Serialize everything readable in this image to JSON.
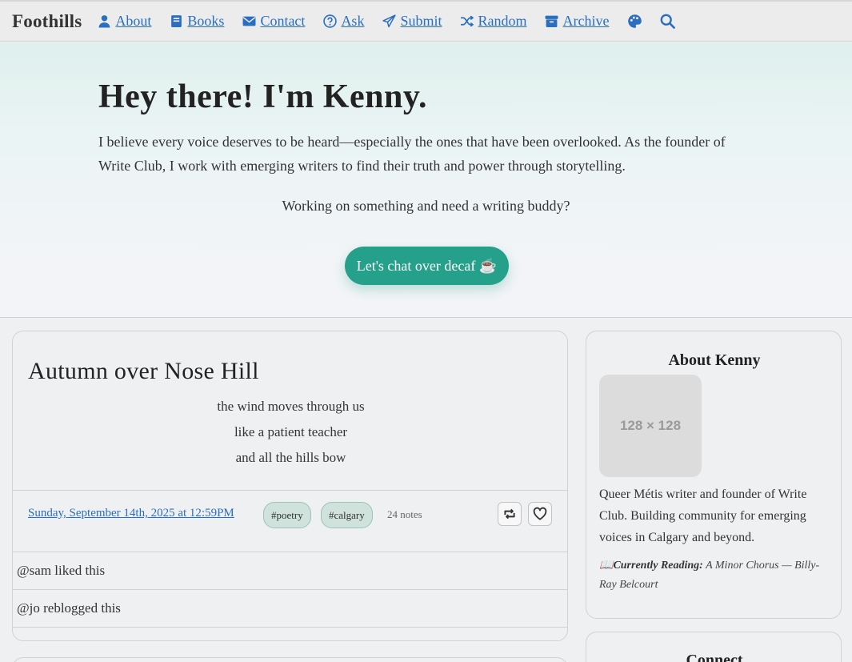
{
  "nav": {
    "brand": "Foothills",
    "links": [
      {
        "label": "About",
        "icon": "user-icon"
      },
      {
        "label": "Books",
        "icon": "book-icon"
      },
      {
        "label": "Contact",
        "icon": "envelope-icon"
      },
      {
        "label": "Ask",
        "icon": "question-circle-icon"
      },
      {
        "label": "Submit",
        "icon": "paper-plane-icon"
      },
      {
        "label": "Random",
        "icon": "shuffle-icon"
      },
      {
        "label": "Archive",
        "icon": "archive-box-icon"
      }
    ],
    "extra_icons": [
      "palette-icon",
      "search-icon"
    ]
  },
  "hero": {
    "title": "Hey there! I'm Kenny.",
    "intro": "I believe every voice deserves to be heard—especially the ones that have been overlooked. As the founder of Write Club, I work with emerging writers to find their truth and power through storytelling.",
    "prompt": "Working on something and need a writing buddy?",
    "cta_label": "Let's chat over decaf ☕"
  },
  "post": {
    "title": "Autumn over Nose Hill",
    "poem_lines": [
      "the wind moves through us",
      "like a patient teacher",
      "and all the hills bow"
    ],
    "date": "Sunday, September 14th, 2025 at 12:59PM",
    "tags": [
      "#poetry",
      "#calgary"
    ],
    "notes": "24 notes",
    "activity": [
      "@sam liked this",
      "@jo reblogged this"
    ]
  },
  "sidebar": {
    "about_title": "About Kenny",
    "avatar_placeholder": "128 × 128",
    "bio": "Queer Métis writer and founder of Write Club. Building community for emerging voices in Calgary and beyond.",
    "reading_emoji": "📖",
    "reading_label": "Currently Reading:",
    "reading_value": "A Minor Chorus — Billy-Ray Belcourt",
    "connect_title": "Connect"
  },
  "colors": {
    "accent": "#25a08a",
    "link": "#2a6ec0",
    "tag_bg": "#cfe2dc"
  }
}
